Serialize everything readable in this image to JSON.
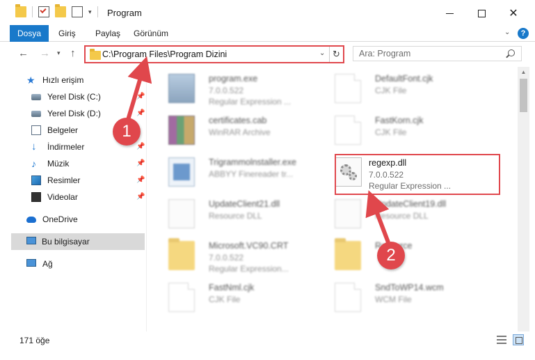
{
  "window": {
    "title": "Program"
  },
  "ribbon": {
    "tabs": [
      "Dosya",
      "Giriş",
      "Paylaş",
      "Görünüm"
    ],
    "help": "?"
  },
  "nav": {
    "address": "C:\\Program Files\\Program Dizini",
    "search_placeholder": "Ara: Program"
  },
  "sidebar": {
    "items": [
      {
        "label": "Hızlı erişim",
        "icon": "star-icon"
      },
      {
        "label": "Yerel Disk (C:)",
        "icon": "drive-icon"
      },
      {
        "label": "Yerel Disk (D:)",
        "icon": "drive-icon"
      },
      {
        "label": "Belgeler",
        "icon": "documents-icon"
      },
      {
        "label": "İndirmeler",
        "icon": "download-icon"
      },
      {
        "label": "Müzik",
        "icon": "music-icon"
      },
      {
        "label": "Resimler",
        "icon": "pictures-icon"
      },
      {
        "label": "Videolar",
        "icon": "videos-icon"
      },
      {
        "label": "OneDrive",
        "icon": "cloud-icon"
      },
      {
        "label": "Bu bilgisayar",
        "icon": "computer-icon"
      },
      {
        "label": "Ağ",
        "icon": "network-icon"
      }
    ]
  },
  "files": [
    {
      "name": "program.exe",
      "version": "7.0.0.522",
      "type": "Regular Expression ...",
      "icon": "exe-icon"
    },
    {
      "name": "DefaultFont.cjk",
      "version": "CJK File",
      "type": "",
      "icon": "file-icon"
    },
    {
      "name": "certificates.cab",
      "version": "WinRAR Archive",
      "type": "",
      "icon": "archive-icon"
    },
    {
      "name": "FastKorn.cjk",
      "version": "CJK File",
      "type": "",
      "icon": "file-icon"
    },
    {
      "name": "Trigrammolnstaller.exe",
      "version": "ABBYY Finereader tr...",
      "type": "",
      "icon": "installer-icon"
    },
    {
      "name": "regexp.dll",
      "version": "7.0.0.522",
      "type": "Regular Expression ...",
      "icon": "dll-icon"
    },
    {
      "name": "UpdateClient21.dll",
      "version": "Resource DLL",
      "type": "",
      "icon": "dll-icon"
    },
    {
      "name": "UpdateClient19.dll",
      "version": "Resource DLL",
      "type": "",
      "icon": "dll-icon"
    },
    {
      "name": "Microsoft.VC90.CRT",
      "version": "7.0.0.522",
      "type": "Regular Expression...",
      "icon": "folder-icon"
    },
    {
      "name": "Resource",
      "version": "",
      "type": "",
      "icon": "folder-icon"
    },
    {
      "name": "FastNml.cjk",
      "version": "CJK File",
      "type": "",
      "icon": "file-icon"
    },
    {
      "name": "SndToWP14.wcm",
      "version": "WCM File",
      "type": "",
      "icon": "file-icon"
    }
  ],
  "callouts": [
    "1",
    "2"
  ],
  "status": {
    "count": "171 öğe"
  },
  "colors": {
    "accent": "#1979ca",
    "highlight": "#e0474c"
  }
}
